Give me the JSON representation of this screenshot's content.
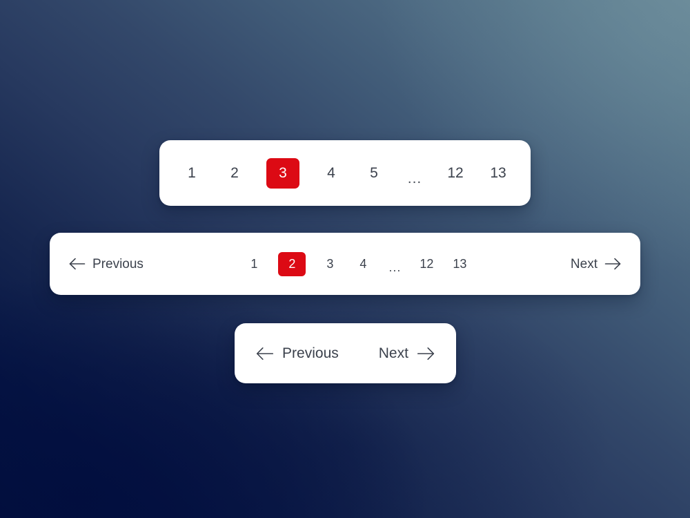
{
  "theme": {
    "accent_red": "#DC0A14",
    "text_dark": "#3B414C",
    "card_bg": "#FFFFFF",
    "bg_gradient_from": "#02103F",
    "bg_gradient_to": "#62828F"
  },
  "numbers_pagination": {
    "name": "numbers-only-pagination",
    "active_page": "3",
    "items": [
      {
        "label": "1",
        "type": "page",
        "active": false
      },
      {
        "label": "2",
        "type": "page",
        "active": false
      },
      {
        "label": "3",
        "type": "page",
        "active": true
      },
      {
        "label": "4",
        "type": "page",
        "active": false
      },
      {
        "label": "5",
        "type": "page",
        "active": false
      },
      {
        "label": "...",
        "type": "ellipsis",
        "active": false
      },
      {
        "label": "12",
        "type": "page",
        "active": false
      },
      {
        "label": "13",
        "type": "page",
        "active": false
      }
    ]
  },
  "full_pagination": {
    "name": "full-pagination",
    "previous_label": "Previous",
    "next_label": "Next",
    "previous_icon": "arrow-left-icon",
    "next_icon": "arrow-right-icon",
    "active_page": "2",
    "items": [
      {
        "label": "1",
        "type": "page",
        "active": false
      },
      {
        "label": "2",
        "type": "page",
        "active": true
      },
      {
        "label": "3",
        "type": "page",
        "active": false
      },
      {
        "label": "4",
        "type": "page",
        "active": false
      },
      {
        "label": "...",
        "type": "ellipsis",
        "active": false
      },
      {
        "label": "12",
        "type": "page",
        "active": false
      },
      {
        "label": "13",
        "type": "page",
        "active": false
      }
    ]
  },
  "simple_pagination": {
    "name": "simple-prev-next-pagination",
    "previous_label": "Previous",
    "next_label": "Next",
    "previous_icon": "arrow-left-icon",
    "next_icon": "arrow-right-icon"
  }
}
